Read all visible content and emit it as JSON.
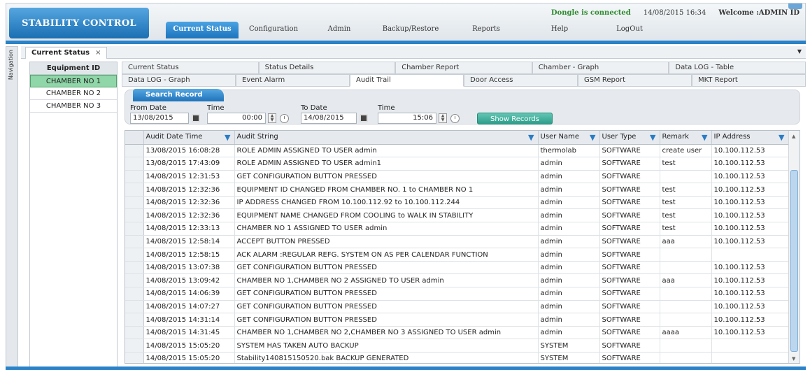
{
  "header": {
    "brand": "STABILITY CONTROL",
    "dongle_status": "Dongle is connected",
    "datetime": "14/08/2015 16:34",
    "welcome": "Welcome :ADMIN ID",
    "menu": [
      {
        "label": "Current Status",
        "active": true
      },
      {
        "label": "Configuration",
        "active": false
      },
      {
        "label": "Admin",
        "active": false
      },
      {
        "label": "Backup/Restore",
        "active": false
      },
      {
        "label": "Reports",
        "active": false
      },
      {
        "label": "Help",
        "active": false
      },
      {
        "label": "LogOut",
        "active": false
      }
    ]
  },
  "navigation_label": "Navigation",
  "doc_tab": {
    "label": "Current Status",
    "close": "×",
    "dropdown": "▼"
  },
  "equipment": {
    "header": "Equipment ID",
    "items": [
      "CHAMBER NO 1",
      "CHAMBER NO 2",
      "CHAMBER NO 3"
    ],
    "selected_index": 0
  },
  "report_tabs": {
    "row1": [
      "Current Status",
      "Status Details",
      "Chamber Report",
      "Chamber - Graph",
      "Data LOG - Table"
    ],
    "row2": [
      "Data LOG - Graph",
      "Event Alarm",
      "Audit Trail",
      "Door Access",
      "GSM Report",
      "MKT Report"
    ],
    "active": "Audit Trail"
  },
  "search": {
    "title": "Search Record",
    "from_date_label": "From Date",
    "from_date": "13/08/2015",
    "from_time_label": "Time",
    "from_time": "00:00",
    "to_date_label": "To Date",
    "to_date": "14/08/2015",
    "to_time_label": "Time",
    "to_time": "15:06",
    "show_button": "Show Records"
  },
  "grid": {
    "columns": [
      "Audit Date Time",
      "Audit String",
      "User Name",
      "User Type",
      "Remark",
      "IP Address"
    ],
    "rows": [
      [
        "13/08/2015 16:08:28",
        "ROLE ADMIN ASSIGNED TO USER admin",
        "thermolab",
        "SOFTWARE",
        "create user",
        "10.100.112.53"
      ],
      [
        "13/08/2015 17:43:09",
        "ROLE ADMIN ASSIGNED TO USER admin1",
        "admin",
        "SOFTWARE",
        "test",
        "10.100.112.53"
      ],
      [
        "14/08/2015 12:31:53",
        "GET CONFIGURATION BUTTON PRESSED",
        "admin",
        "SOFTWARE",
        "",
        "10.100.112.53"
      ],
      [
        "14/08/2015 12:32:36",
        "EQUIPMENT ID CHANGED FROM  CHAMBER NO. 1  to  CHAMBER NO  1",
        "admin",
        "SOFTWARE",
        "test",
        "10.100.112.53"
      ],
      [
        "14/08/2015 12:32:36",
        "IP ADDRESS CHANGED FROM  10.100.112.92  to  10.100.112.244",
        "admin",
        "SOFTWARE",
        "test",
        "10.100.112.53"
      ],
      [
        "14/08/2015 12:32:36",
        "EQUIPMENT NAME CHANGED FROM  COOLING  to  WALK IN STABILITY",
        "admin",
        "SOFTWARE",
        "test",
        "10.100.112.53"
      ],
      [
        "14/08/2015 12:33:13",
        "CHAMBER NO  1 ASSIGNED TO USER admin",
        "admin",
        "SOFTWARE",
        "test",
        "10.100.112.53"
      ],
      [
        "14/08/2015 12:58:14",
        "ACCEPT BUTTON PRESSED",
        "admin",
        "SOFTWARE",
        "aaa",
        "10.100.112.53"
      ],
      [
        "14/08/2015 12:58:15",
        "ACK ALARM :REGULAR REFG. SYSTEM ON AS PER CALENDAR FUNCTION",
        "admin",
        "SOFTWARE",
        "",
        ""
      ],
      [
        "14/08/2015 13:07:38",
        "GET CONFIGURATION BUTTON PRESSED",
        "admin",
        "SOFTWARE",
        "",
        "10.100.112.53"
      ],
      [
        "14/08/2015 13:09:42",
        "CHAMBER NO  1,CHAMBER NO 2 ASSIGNED TO USER admin",
        "admin",
        "SOFTWARE",
        "aaa",
        "10.100.112.53"
      ],
      [
        "14/08/2015 14:06:39",
        "GET CONFIGURATION BUTTON PRESSED",
        "admin",
        "SOFTWARE",
        "",
        "10.100.112.53"
      ],
      [
        "14/08/2015 14:07:27",
        "GET CONFIGURATION BUTTON PRESSED",
        "admin",
        "SOFTWARE",
        "",
        "10.100.112.53"
      ],
      [
        "14/08/2015 14:31:14",
        "GET CONFIGURATION BUTTON PRESSED",
        "admin",
        "SOFTWARE",
        "",
        "10.100.112.53"
      ],
      [
        "14/08/2015 14:31:45",
        "CHAMBER NO  1,CHAMBER NO 2,CHAMBER NO 3 ASSIGNED TO USER admin",
        "admin",
        "SOFTWARE",
        "aaaa",
        "10.100.112.53"
      ],
      [
        "14/08/2015 15:05:20",
        "SYSTEM HAS TAKEN AUTO BACKUP",
        "SYSTEM",
        "SOFTWARE",
        "",
        ""
      ],
      [
        "14/08/2015 15:05:20",
        "Stability140815150520.bak  BACKUP GENERATED",
        "SYSTEM",
        "SOFTWARE",
        "",
        ""
      ]
    ]
  },
  "colors": {
    "accent_blue": "#1c74bd",
    "dongle_green": "#2e8b2e",
    "selected_equipment": "#8fd6a8",
    "show_button": "#2e9d8a"
  }
}
